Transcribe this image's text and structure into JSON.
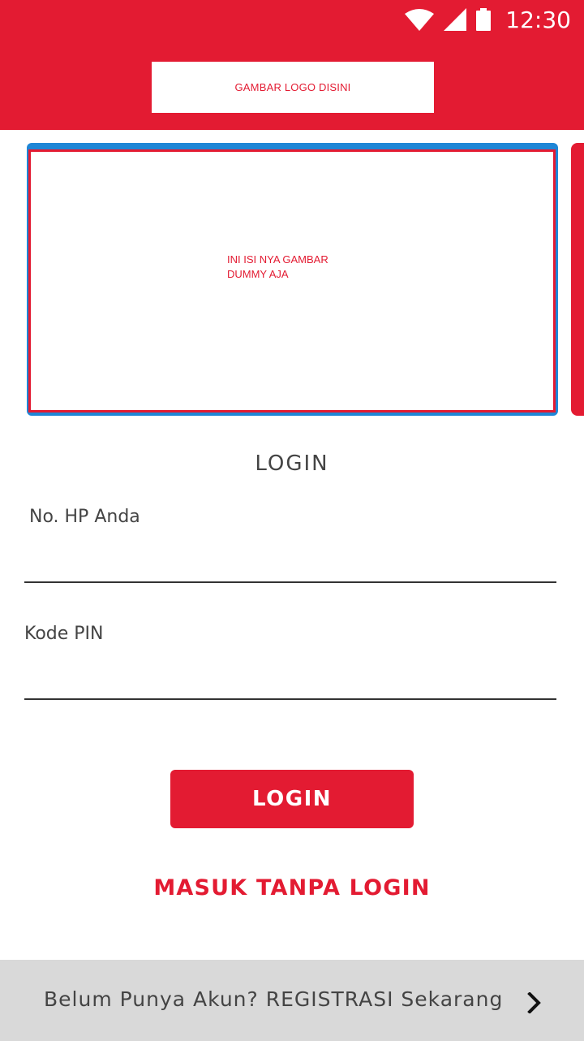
{
  "status_bar": {
    "time": "12:30",
    "icons": [
      "wifi-icon",
      "signal-icon",
      "battery-icon"
    ],
    "color": "#ffffff"
  },
  "header": {
    "logo_placeholder": "GAMBAR LOGO DISINI",
    "background": "#e31b32"
  },
  "carousel": {
    "slide_text": "INI ISI NYA GAMBAR DUMMY AJA"
  },
  "login_form": {
    "title": "LOGIN",
    "phone_label": "No. HP Anda",
    "phone_value": "",
    "pin_label": "Kode PIN",
    "pin_value": "",
    "submit_label": "LOGIN"
  },
  "guest_link": "MASUK TANPA LOGIN",
  "register": {
    "text": "Belum Punya Akun? REGISTRASI Sekarang",
    "icon": "chevron-right-icon"
  },
  "colors": {
    "accent": "#e31b32",
    "footer_bg": "#d9d9d9",
    "slide_frame": "#1f86d6"
  }
}
